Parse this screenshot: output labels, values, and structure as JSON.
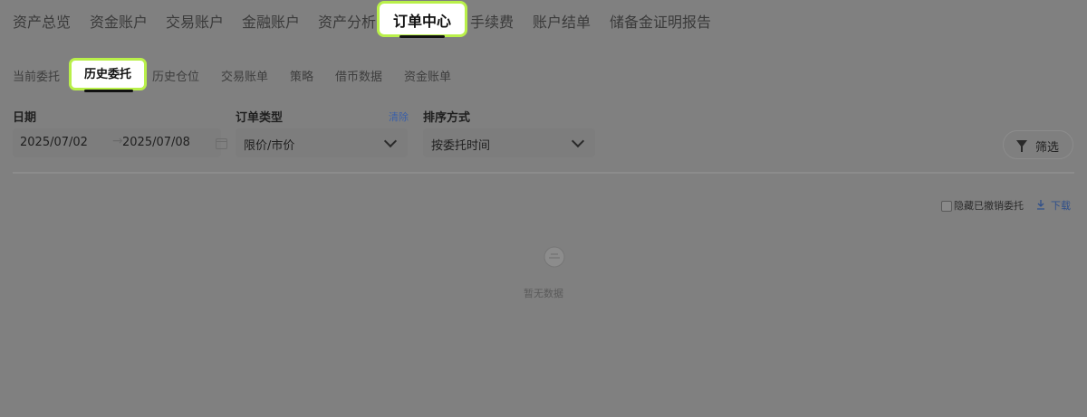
{
  "topnav": {
    "items": [
      "资产总览",
      "资金账户",
      "交易账户",
      "金融账户",
      "资产分析",
      "订单中心",
      "手续费",
      "账户结单",
      "储备金证明报告"
    ],
    "active": "订单中心"
  },
  "subtabs": {
    "items": [
      "当前委托",
      "历史委托",
      "历史仓位",
      "交易账单",
      "策略",
      "借币数据",
      "资金账单"
    ],
    "active": "历史委托"
  },
  "filters": {
    "date_label": "日期",
    "date_from": "2025/07/02",
    "date_to": "2025/07/08",
    "order_type_label": "订单类型",
    "clear_label": "清除",
    "order_type_value": "限价/市价",
    "sort_label": "排序方式",
    "sort_value": "按委托时间",
    "filter_button": "筛选"
  },
  "toolbar": {
    "hide_cancelled": "隐藏已撤销委托",
    "download": "下载"
  },
  "empty": {
    "text": "暂无数据"
  },
  "colors": {
    "highlight": "#b9f04a",
    "link": "#3a5fa8",
    "overlay_bg": "#808080"
  },
  "icons": [
    "chevron-down-icon",
    "arrow-right-icon",
    "calendar-icon",
    "filter-icon",
    "download-icon",
    "empty-box-icon"
  ]
}
